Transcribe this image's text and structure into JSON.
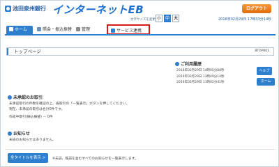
{
  "header": {
    "bank_name": "池田泉州銀行",
    "service_name": "インターネットEB",
    "logout_label": "ログアウト",
    "font_size_label": "文字サイズを変更",
    "font_sizes": [
      "小",
      "中",
      "大"
    ],
    "selected_font_size": "中",
    "datetime": "2016年02月29日 17時33分14秒"
  },
  "nav": {
    "tabs": [
      {
        "label": "ホーム",
        "icon": "home-icon",
        "active": true
      },
      {
        "label": "照会・振込振替",
        "icon": "inquiry-icon",
        "active": false
      },
      {
        "label": "管理",
        "icon": "manage-icon",
        "active": false
      },
      {
        "label": "サービス連携",
        "icon": "service-link-icon",
        "active": false,
        "highlighted": true
      }
    ]
  },
  "page": {
    "title": "トップページ",
    "code": "BTOP001"
  },
  "history": {
    "heading": "ご利用履歴",
    "entries": [
      "2016年02月29日 14時05分08秒",
      "2016年02月29日 13時49分14秒",
      "2016年02月29日 11時02分41秒"
    ]
  },
  "side_buttons": {
    "help": "ヘルプ",
    "home": "ホーム"
  },
  "pending": {
    "heading": "未承認のお取引",
    "line1": "未承認取引の件数を確認の上、各取引の「一覧表示」ボタンを押してください。",
    "line2": "現在、未承認の取引は合計0件です。",
    "line3": "作成中取引(振込振替) － 0件"
  },
  "notices": {
    "heading": "お知らせ",
    "empty_text": "未読のお知らせはありません。",
    "show_all_label": "全タイトルを表示 >",
    "show_all_note": "※未読、既読を含むすべてのお知らせを一覧表示します。"
  },
  "colors": {
    "accent": "#2f7fcf",
    "logout": "#e06f10",
    "highlight_border": "#d41a1a"
  }
}
